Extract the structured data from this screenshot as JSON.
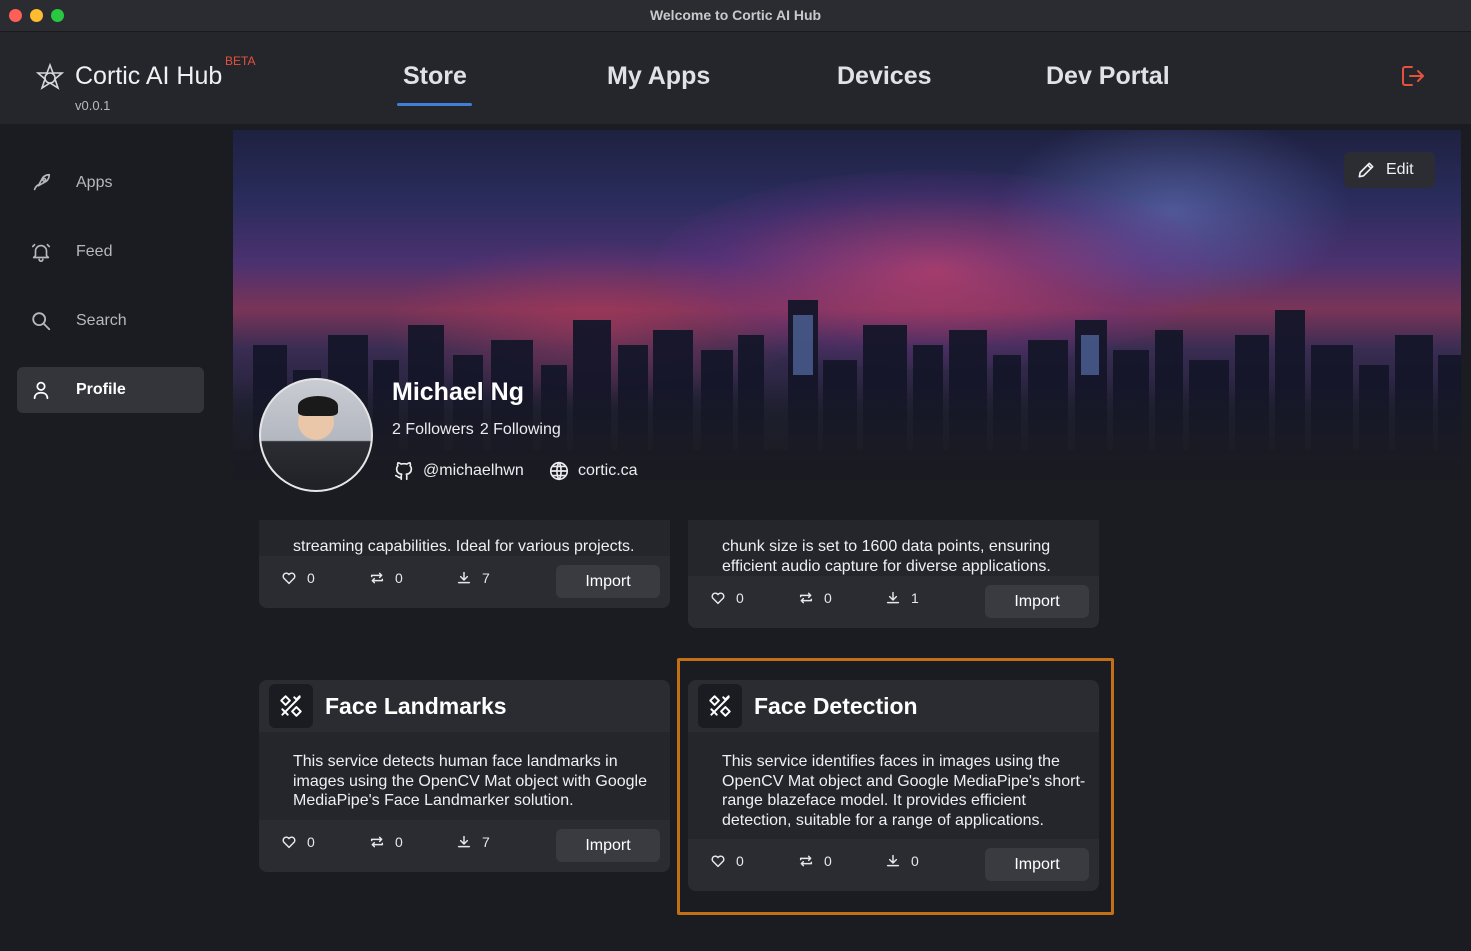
{
  "window": {
    "title": "Welcome to Cortic AI Hub"
  },
  "brand": {
    "name": "Cortic AI Hub",
    "badge": "BETA",
    "version": "v0.0.1"
  },
  "nav": {
    "store": "Store",
    "my_apps": "My Apps",
    "devices": "Devices",
    "dev_portal": "Dev Portal",
    "active": "Store"
  },
  "sidebar": {
    "items": [
      {
        "label": "Apps",
        "icon": "rocket-icon"
      },
      {
        "label": "Feed",
        "icon": "bell-icon"
      },
      {
        "label": "Search",
        "icon": "search-icon"
      },
      {
        "label": "Profile",
        "icon": "user-icon",
        "active": true
      }
    ]
  },
  "profile": {
    "name": "Michael Ng",
    "followers": "2 Followers",
    "following": "2 Following",
    "github": "@michaelhwn",
    "website": "cortic.ca",
    "edit_label": "Edit"
  },
  "cards": [
    {
      "desc_partial": "streaming capabilities. Ideal for various projects.",
      "likes": "0",
      "shares": "0",
      "downloads": "7",
      "import_label": "Import"
    },
    {
      "desc_partial_1": "chunk size is set to 1600 data points, ensuring",
      "desc_partial_2": "efficient audio capture for diverse applications.",
      "likes": "0",
      "shares": "0",
      "downloads": "1",
      "import_label": "Import"
    },
    {
      "title": "Face Landmarks",
      "desc": "This service detects human face landmarks in images using the OpenCV Mat object with Google MediaPipe's Face Landmarker solution.",
      "likes": "0",
      "shares": "0",
      "downloads": "7",
      "import_label": "Import"
    },
    {
      "title": "Face Detection",
      "desc": "This service identifies faces in images using the OpenCV Mat object and Google MediaPipe's short-range blazeface model. It provides efficient detection, suitable for a range of applications.",
      "likes": "0",
      "shares": "0",
      "downloads": "0",
      "import_label": "Import"
    }
  ],
  "colors": {
    "accent": "#3f7fd8",
    "highlight": "#c26f16",
    "logout": "#e4513d",
    "beta": "#e4513d"
  }
}
